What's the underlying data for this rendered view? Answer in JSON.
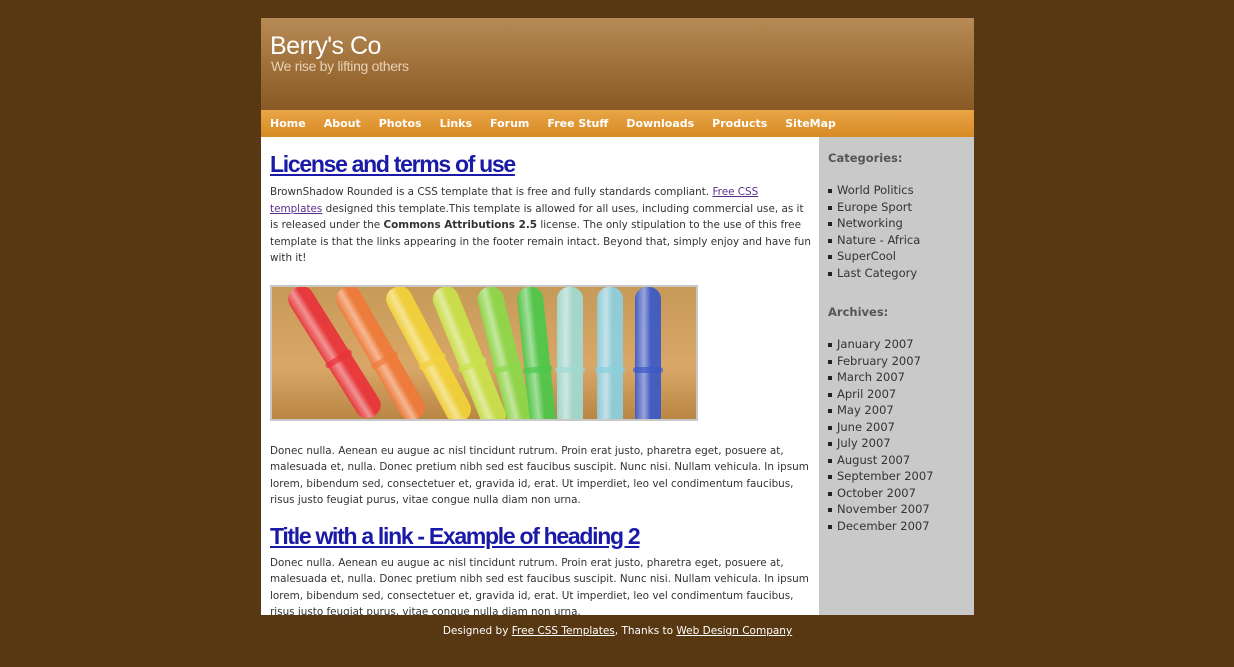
{
  "header": {
    "title": "Berry's Co",
    "slogan": "We rise by lifting others"
  },
  "nav": [
    "Home",
    "About",
    "Photos",
    "Links",
    "Forum",
    "Free Stuff",
    "Downloads",
    "Products",
    "SiteMap"
  ],
  "main": {
    "heading_1": "License and terms of use",
    "intro": {
      "part1": "BrownShadow Rounded is a CSS template that is free and fully standards compliant. ",
      "link": "Free CSS templates",
      "part2": " designed this template.This template is allowed for all uses, including commercial use, as it is released under the ",
      "bold": "Commons Attributions 2.5",
      "part3": " license. The only stipulation to the use of this free template is that the links appearing in the footer remain intact. Beyond that, simply enjoy and have fun with it!"
    },
    "paragraph_2": "Donec nulla. Aenean eu augue ac nisl tincidunt rutrum. Proin erat justo, pharetra eget, posuere at, malesuada et, nulla. Donec pretium nibh sed est faucibus suscipit. Nunc nisi. Nullam vehicula. In ipsum lorem, bibendum sed, consectetuer et, gravida id, erat. Ut imperdiet, leo vel condimentum faucibus, risus justo feugiat purus, vitae congue nulla diam non urna.",
    "heading_2": "Title with a link - Example of heading 2",
    "paragraph_3": "Donec nulla. Aenean eu augue ac nisl tincidunt rutrum. Proin erat justo, pharetra eget, posuere at, malesuada et, nulla. Donec pretium nibh sed est faucibus suscipit. Nunc nisi. Nullam vehicula. In ipsum lorem, bibendum sed, consectetuer et, gravida id, erat. Ut imperdiet, leo vel condimentum faucibus, risus justo feugiat purus, vitae congue nulla diam non urna."
  },
  "sidebar": {
    "categories_title": "Categories:",
    "categories": [
      "World Politics",
      "Europe Sport",
      "Networking",
      "Nature - Africa",
      "SuperCool",
      "Last Category"
    ],
    "archives_title": "Archives:",
    "archives": [
      "January 2007",
      "February 2007",
      "March 2007",
      "April 2007",
      "May 2007",
      "June 2007",
      "July 2007",
      "August 2007",
      "September 2007",
      "October 2007",
      "November 2007",
      "December 2007"
    ]
  },
  "footer": {
    "prefix": "Designed by ",
    "link1": "Free CSS Templates",
    "middle": ", Thanks to ",
    "link2": "Web Design Company"
  },
  "colors": {
    "background": "#583812",
    "header": "#9e6e38",
    "nav": "#d78a25",
    "heading_link": "#1a1aa6",
    "sidebar": "#c9c9c9"
  }
}
